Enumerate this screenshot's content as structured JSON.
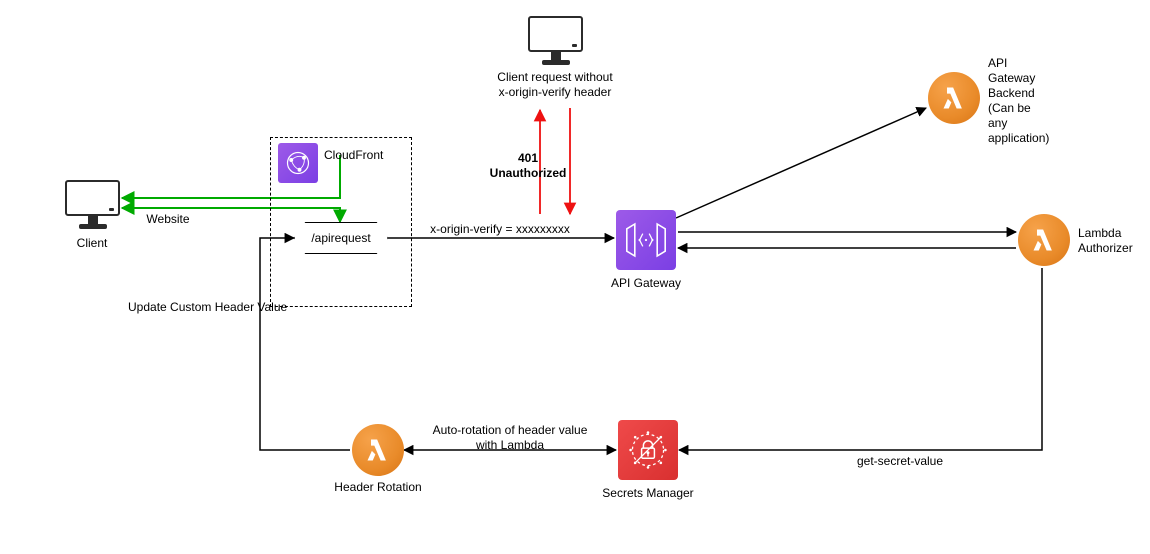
{
  "nodes": {
    "client": {
      "label": "Client"
    },
    "unauth_client": {
      "label": "Client request without\nx-origin-verify header"
    },
    "cloudfront": {
      "label": "CloudFront"
    },
    "apirequest": {
      "label": "/apirequest"
    },
    "api_gateway": {
      "label": "API Gateway"
    },
    "backend_lambda": {
      "label": "API\nGateway\nBackend\n(Can be\nany\napplication)"
    },
    "lambda_authorizer": {
      "label": "Lambda\nAuthorizer"
    },
    "header_rotation": {
      "label": "Header Rotation"
    },
    "secrets_manager": {
      "label": "Secrets Manager"
    }
  },
  "edges": {
    "website": "Website",
    "x_origin_verify": "x-origin-verify = xxxxxxxxx",
    "unauthorized": "401\nUnauthorized",
    "update_header": "Update Custom Header Value",
    "auto_rotation": "Auto-rotation of header value\nwith Lambda",
    "get_secret": "get-secret-value"
  }
}
